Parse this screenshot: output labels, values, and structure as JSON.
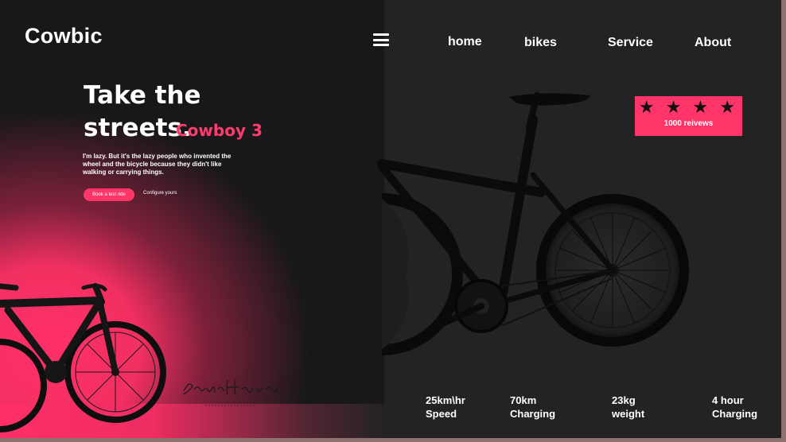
{
  "brand": "Cowbic",
  "nav": {
    "home": "home",
    "bikes": "bikes",
    "service": "Service",
    "about": "About"
  },
  "hero": {
    "line1": "Take the",
    "line2": "streets.",
    "model": "Cowboy 3",
    "description": "I'm lazy. But it's the lazy people who invented the wheel and the bicycle because they didn't like walking or carrying things.",
    "cta_primary": "Book a test ride",
    "cta_secondary": "Configure yours"
  },
  "reviews": {
    "stars": "★ ★ ★ ★",
    "count_label": "1000 reivews",
    "rating": 4
  },
  "signature": {
    "name": "Sandra Havers"
  },
  "stats": [
    {
      "value": "25km\\hr",
      "label": "Speed"
    },
    {
      "value": "70km",
      "label": "Charging"
    },
    {
      "value": "23kg",
      "label": "weight"
    },
    {
      "value": "4 hour",
      "label": "Charging"
    }
  ],
  "colors": {
    "accent": "#ff3468",
    "background": "#232324",
    "left_panel": "#18181a",
    "text": "#ffffff"
  }
}
